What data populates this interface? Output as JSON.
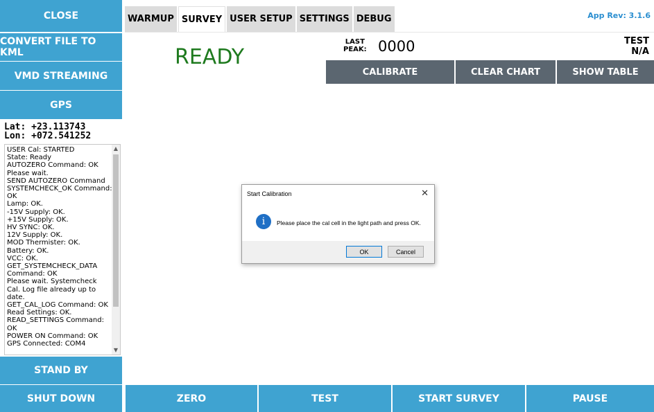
{
  "sidebar": {
    "close": "CLOSE",
    "convert_kml": "CONVERT FILE TO KML",
    "vmd_streaming": "VMD STREAMING",
    "gps": "GPS",
    "lat": "Lat: +23.113743",
    "lon": "Lon: +072.541252",
    "standby": "STAND BY",
    "shutdown": "SHUT DOWN"
  },
  "log": {
    "lines": [
      "USER Cal: STARTED",
      "State: Ready",
      "AUTOZERO Command: OK",
      "Please wait.",
      "SEND AUTOZERO Command",
      "SYSTEMCHECK_OK Command:",
      "OK",
      "Lamp: OK.",
      "-15V Supply: OK.",
      "+15V Supply: OK.",
      "HV SYNC: OK.",
      "12V Supply: OK.",
      "MOD Thermister: OK.",
      "Battery: OK.",
      "VCC: OK.",
      "GET_SYSTEMCHECK_DATA",
      "Command: OK",
      "Please wait. Systemcheck",
      "Cal. Log file already up to",
      "date.",
      "GET_CAL_LOG Command: OK",
      "Read Settings: OK.",
      "READ_SETTINGS Command:",
      "OK",
      "POWER ON Command: OK",
      "GPS Connected: COM4"
    ]
  },
  "tabs": [
    "WARMUP",
    "SURVEY",
    "USER SETUP",
    "SETTINGS",
    "DEBUG"
  ],
  "active_tab": "SURVEY",
  "app_rev": "App Rev: 3.1.6",
  "status": "READY",
  "last_peak_label": "LAST PEAK:",
  "last_peak_value": "0000",
  "test_label": "TEST",
  "test_value": "N/A",
  "toolbar": {
    "calibrate": "CALIBRATE",
    "clear_chart": "CLEAR CHART",
    "show_table": "SHOW TABLE"
  },
  "bottom": {
    "zero": "ZERO",
    "test": "TEST",
    "start_survey": "START SURVEY",
    "pause": "PAUSE"
  },
  "dialog": {
    "title": "Start Calibration",
    "message": "Please place the cal cell in the light path and press OK.",
    "ok": "OK",
    "cancel": "Cancel"
  },
  "colors": {
    "accent": "#3fa3d1",
    "dark_button": "#5b6670",
    "ready": "#1e7a1e",
    "app_rev": "#2a8ed0"
  }
}
